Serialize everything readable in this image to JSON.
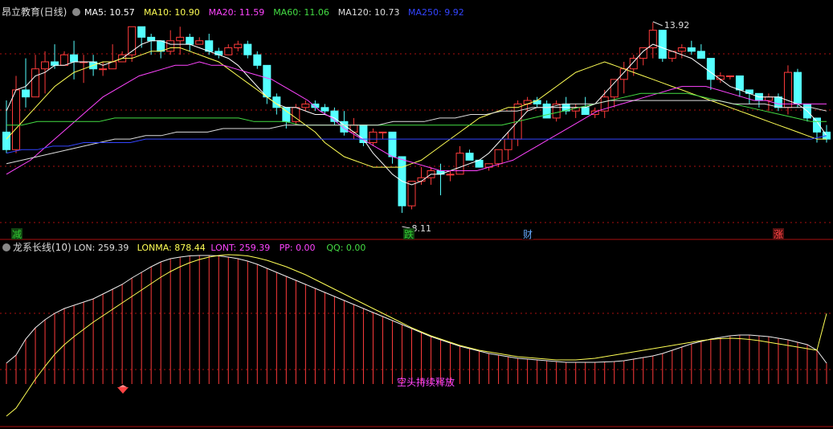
{
  "main_panel": {
    "title": "昂立教育(日线)",
    "ma_labels": [
      {
        "name": "MA5",
        "value": "10.57",
        "color": "#ffffff"
      },
      {
        "name": "MA10",
        "value": "10.90",
        "color": "#ffff55"
      },
      {
        "name": "MA20",
        "value": "11.59",
        "color": "#ff44ff"
      },
      {
        "name": "MA60",
        "value": "11.06",
        "color": "#44dd44"
      },
      {
        "name": "MA120",
        "value": "10.73",
        "color": "#dddddd"
      },
      {
        "name": "MA250",
        "value": "9.92",
        "color": "#3344ff"
      }
    ],
    "high_label": "13.92",
    "low_label": "8.11",
    "markers": [
      {
        "text": "减",
        "color": "#33cc33",
        "bg": "#114411"
      },
      {
        "text": "跌",
        "color": "#33cc33",
        "bg": "#114411"
      },
      {
        "text": "财",
        "color": "#66aaff",
        "bg": "#000000"
      },
      {
        "text": "涨",
        "color": "#ff4444",
        "bg": "#551111"
      }
    ]
  },
  "sub_panel": {
    "title": "龙系长线(10)",
    "labels": [
      {
        "name": "LON",
        "value": "259.39",
        "color": "#dddddd"
      },
      {
        "name": "LONMA",
        "value": "878.44",
        "color": "#ffff55"
      },
      {
        "name": "LONT",
        "value": "259.39",
        "color": "#ff44ff"
      },
      {
        "name": "PP",
        "value": "0.00",
        "color": "#ff44ff"
      },
      {
        "name": "QQ",
        "value": "0.00",
        "color": "#44dd44"
      }
    ],
    "annotation": "空头持续释放"
  },
  "colors": {
    "up": "#ff3b3b",
    "down": "#55ffff",
    "grid": "#aa1111",
    "border": "#aa1111"
  },
  "chart_data": [
    {
      "type": "candlestick",
      "title": "昂立教育(日线)",
      "high_marker": 13.92,
      "low_marker": 8.11,
      "ohlc": [
        [
          10.8,
          11.7,
          10.2,
          10.3
        ],
        [
          10.3,
          12.4,
          10.2,
          12.0
        ],
        [
          12.0,
          12.9,
          11.5,
          11.8
        ],
        [
          11.8,
          13.0,
          11.8,
          12.6
        ],
        [
          12.6,
          13.1,
          11.9,
          12.8
        ],
        [
          12.8,
          13.3,
          12.6,
          12.7
        ],
        [
          12.7,
          13.1,
          12.8,
          13.0
        ],
        [
          13.0,
          13.4,
          12.3,
          12.8
        ],
        [
          12.8,
          13.0,
          12.2,
          12.8
        ],
        [
          12.8,
          13.0,
          12.4,
          12.6
        ],
        [
          12.6,
          12.8,
          12.4,
          12.6
        ],
        [
          12.6,
          13.3,
          12.6,
          12.8
        ],
        [
          12.8,
          13.1,
          12.8,
          13.0
        ],
        [
          13.0,
          13.8,
          12.8,
          13.8
        ],
        [
          13.8,
          13.8,
          13.2,
          13.5
        ],
        [
          13.5,
          13.6,
          13.0,
          13.4
        ],
        [
          13.4,
          13.3,
          12.9,
          13.1
        ],
        [
          13.1,
          13.7,
          13.0,
          13.4
        ],
        [
          13.4,
          13.8,
          13.0,
          13.5
        ],
        [
          13.5,
          13.6,
          13.1,
          13.3
        ],
        [
          13.3,
          13.5,
          13.3,
          13.4
        ],
        [
          13.4,
          13.6,
          13.0,
          13.1
        ],
        [
          13.1,
          13.2,
          12.9,
          13.0
        ],
        [
          13.0,
          13.3,
          13.0,
          13.2
        ],
        [
          13.2,
          13.4,
          13.1,
          13.3
        ],
        [
          13.3,
          13.4,
          12.9,
          13.0
        ],
        [
          13.0,
          13.1,
          12.6,
          12.7
        ],
        [
          12.7,
          12.5,
          11.6,
          11.8
        ],
        [
          11.8,
          11.9,
          11.3,
          11.5
        ],
        [
          11.5,
          11.5,
          10.9,
          11.1
        ],
        [
          11.1,
          11.6,
          11.0,
          11.5
        ],
        [
          11.5,
          11.7,
          11.4,
          11.6
        ],
        [
          11.6,
          11.7,
          11.4,
          11.5
        ],
        [
          11.5,
          11.6,
          11.3,
          11.4
        ],
        [
          11.4,
          11.5,
          11.0,
          11.1
        ],
        [
          11.1,
          11.4,
          10.7,
          10.8
        ],
        [
          10.8,
          11.2,
          10.6,
          11.0
        ],
        [
          11.0,
          11.0,
          10.4,
          10.5
        ],
        [
          10.5,
          10.9,
          10.4,
          10.8
        ],
        [
          10.8,
          10.8,
          10.6,
          10.8
        ],
        [
          10.8,
          10.7,
          9.9,
          10.1
        ],
        [
          10.1,
          8.11,
          8.5,
          8.7
        ],
        [
          8.7,
          9.3,
          8.6,
          9.4
        ],
        [
          9.4,
          9.8,
          9.3,
          9.5
        ],
        [
          9.5,
          9.8,
          9.3,
          9.7
        ],
        [
          9.7,
          9.9,
          9.0,
          9.6
        ],
        [
          9.6,
          9.7,
          9.4,
          9.6
        ],
        [
          9.6,
          10.4,
          9.6,
          10.2
        ],
        [
          10.2,
          10.3,
          10.0,
          10.0
        ],
        [
          10.0,
          9.8,
          9.8,
          9.8
        ],
        [
          9.8,
          9.9,
          9.7,
          9.9
        ],
        [
          9.9,
          10.2,
          9.8,
          10.3
        ],
        [
          10.3,
          10.8,
          10.0,
          10.6
        ],
        [
          10.6,
          11.7,
          10.4,
          11.6
        ],
        [
          11.6,
          11.8,
          11.4,
          11.7
        ],
        [
          11.7,
          11.8,
          11.5,
          11.6
        ],
        [
          11.6,
          11.7,
          11.2,
          11.2
        ],
        [
          11.2,
          11.7,
          11.1,
          11.6
        ],
        [
          11.6,
          11.8,
          11.3,
          11.4
        ],
        [
          11.4,
          11.6,
          11.2,
          11.5
        ],
        [
          11.5,
          11.8,
          11.3,
          11.3
        ],
        [
          11.3,
          11.5,
          11.2,
          11.4
        ],
        [
          11.4,
          12.0,
          11.2,
          11.8
        ],
        [
          11.8,
          12.3,
          11.5,
          12.3
        ],
        [
          12.3,
          12.8,
          11.9,
          12.6
        ],
        [
          12.6,
          13.0,
          12.4,
          12.9
        ],
        [
          12.9,
          13.1,
          12.7,
          13.2
        ],
        [
          13.2,
          13.92,
          12.9,
          13.7
        ],
        [
          13.7,
          13.5,
          12.8,
          12.9
        ],
        [
          12.9,
          13.1,
          12.8,
          13.1
        ],
        [
          13.1,
          13.3,
          12.9,
          13.2
        ],
        [
          13.2,
          13.4,
          13.0,
          13.1
        ],
        [
          13.1,
          13.3,
          12.9,
          12.9
        ],
        [
          12.9,
          12.9,
          12.0,
          12.3
        ],
        [
          12.3,
          12.5,
          12.2,
          12.4
        ],
        [
          12.4,
          12.4,
          12.3,
          12.4
        ],
        [
          12.4,
          12.4,
          11.8,
          12.0
        ],
        [
          12.0,
          12.0,
          11.6,
          11.9
        ],
        [
          11.9,
          11.9,
          11.5,
          11.7
        ],
        [
          11.7,
          11.9,
          11.4,
          11.8
        ],
        [
          11.8,
          11.9,
          11.4,
          11.5
        ],
        [
          11.5,
          12.7,
          11.3,
          12.5
        ],
        [
          12.5,
          12.6,
          11.5,
          11.6
        ],
        [
          11.6,
          11.6,
          11.1,
          11.2
        ],
        [
          11.2,
          11.2,
          10.5,
          10.8
        ],
        [
          10.8,
          11.0,
          10.5,
          10.6
        ]
      ],
      "ma_lines": {
        "MA5": [
          11.4,
          12.0,
          12.1,
          12.4,
          12.5,
          12.7,
          12.7,
          12.8,
          12.8,
          12.8,
          12.7,
          12.8,
          12.9,
          13.1,
          13.3,
          13.4,
          13.4,
          13.3,
          13.3,
          13.3,
          13.2,
          13.1,
          13.0,
          12.9,
          12.7,
          12.4,
          12.1,
          11.8,
          11.6,
          11.5,
          11.5,
          11.4,
          11.3,
          11.3,
          11.2,
          11.0,
          10.8,
          10.6,
          10.2,
          9.9,
          9.6,
          9.4,
          9.3,
          9.4,
          9.6,
          9.6,
          9.7,
          9.8,
          9.9,
          10.0,
          10.2,
          10.5,
          10.8,
          11.1,
          11.4,
          11.5,
          11.5,
          11.5,
          11.5,
          11.5,
          11.5,
          11.6,
          11.9,
          12.2,
          12.5,
          12.8,
          13.1,
          13.3,
          13.2,
          13.1,
          13.0,
          12.9,
          12.7,
          12.5,
          12.3,
          12.1,
          12.0,
          11.9,
          11.8,
          11.8,
          11.8,
          11.7,
          11.6,
          11.4,
          11.1,
          10.7
        ],
        "MA10": [
          10.6,
          10.9,
          11.2,
          11.5,
          11.8,
          12.1,
          12.3,
          12.5,
          12.6,
          12.7,
          12.8,
          12.8,
          12.9,
          12.9,
          13.0,
          13.1,
          13.1,
          13.2,
          13.2,
          13.1,
          13.0,
          12.9,
          12.8,
          12.6,
          12.4,
          12.2,
          12.0,
          11.8,
          11.6,
          11.4,
          11.2,
          11.0,
          10.8,
          10.5,
          10.3,
          10.1,
          10.0,
          9.9,
          9.8,
          9.8,
          9.8,
          9.8,
          9.9,
          10.0,
          10.2,
          10.4,
          10.6,
          10.8,
          11.0,
          11.2,
          11.3,
          11.4,
          11.5,
          11.5,
          11.6,
          11.7,
          11.9,
          12.1,
          12.3,
          12.5,
          12.6,
          12.7,
          12.8,
          12.7,
          12.6,
          12.5,
          12.4,
          12.3,
          12.2,
          12.1,
          12.0,
          11.9,
          11.8,
          11.7,
          11.6,
          11.5,
          11.4,
          11.3,
          11.2,
          11.1,
          11.0,
          10.9,
          10.8,
          10.7,
          10.6,
          10.6
        ],
        "MA20": [
          9.6,
          9.8,
          10.0,
          10.3,
          10.6,
          10.9,
          11.2,
          11.5,
          11.8,
          12.0,
          12.2,
          12.4,
          12.5,
          12.6,
          12.7,
          12.7,
          12.8,
          12.7,
          12.7,
          12.6,
          12.5,
          12.4,
          12.3,
          12.1,
          11.9,
          11.7,
          11.4,
          11.2,
          10.9,
          10.7,
          10.5,
          10.3,
          10.1,
          10.0,
          9.9,
          9.8,
          9.7,
          9.7,
          9.7,
          9.7,
          9.8,
          9.9,
          10.0,
          10.2,
          10.4,
          10.6,
          10.8,
          11.0,
          11.2,
          11.4,
          11.5,
          11.6,
          11.7,
          11.8,
          11.9,
          12.0,
          12.1,
          12.1,
          12.1,
          12.0,
          11.9,
          11.8,
          11.7,
          11.7,
          11.6,
          11.6,
          11.6,
          11.6,
          11.6
        ],
        "MA60": [
          11.0,
          11.0,
          11.1,
          11.1,
          11.1,
          11.1,
          11.1,
          11.2,
          11.2,
          11.2,
          11.2,
          11.2,
          11.2,
          11.2,
          11.2,
          11.2,
          11.1,
          11.1,
          11.1,
          11.0,
          11.0,
          11.0,
          11.0,
          11.0,
          11.0,
          11.0,
          11.0,
          11.0,
          11.0,
          11.0,
          11.0,
          11.0,
          11.0,
          11.1,
          11.2,
          11.3,
          11.4,
          11.5,
          11.6,
          11.7,
          11.8,
          11.9,
          11.9,
          11.9,
          11.9,
          11.8,
          11.7,
          11.6,
          11.5,
          11.4,
          11.3,
          11.2,
          11.1,
          11.1
        ],
        "MA120": [
          9.9,
          10.0,
          10.1,
          10.2,
          10.3,
          10.4,
          10.5,
          10.6,
          10.6,
          10.7,
          10.7,
          10.8,
          10.8,
          10.8,
          10.9,
          10.9,
          10.9,
          10.9,
          11.0,
          11.0,
          11.0,
          11.0,
          11.0,
          11.0,
          11.0,
          11.1,
          11.1,
          11.1,
          11.2,
          11.2,
          11.3,
          11.3,
          11.4,
          11.4,
          11.5,
          11.5,
          11.6,
          11.6,
          11.6,
          11.7,
          11.7,
          11.7,
          11.7,
          11.7,
          11.7,
          11.7,
          11.7,
          11.6,
          11.6,
          11.6,
          11.5,
          11.5,
          11.5,
          11.4
        ],
        "MA250": [
          10.2,
          10.3,
          10.3,
          10.4,
          10.4,
          10.5,
          10.5,
          10.5,
          10.5,
          10.6,
          10.6,
          10.6,
          10.6,
          10.6,
          10.6,
          10.6,
          10.6,
          10.6,
          10.6,
          10.6,
          10.6,
          10.6,
          10.6,
          10.6,
          10.6,
          10.6,
          10.6,
          10.6,
          10.6,
          10.6,
          10.6,
          10.6,
          10.6,
          10.6,
          10.6,
          10.6,
          10.6,
          10.6,
          10.6,
          10.6,
          10.6,
          10.6,
          10.6,
          10.6,
          10.6,
          10.6,
          10.6,
          10.6,
          10.6,
          10.6,
          10.6,
          10.6,
          10.6,
          10.7
        ]
      },
      "series": [
        {
          "name": "MA5",
          "value": 10.57
        },
        {
          "name": "MA10",
          "value": 10.9
        },
        {
          "name": "MA20",
          "value": 11.59
        },
        {
          "name": "MA60",
          "value": 11.06
        },
        {
          "name": "MA120",
          "value": 10.73
        },
        {
          "name": "MA250",
          "value": 9.92
        }
      ]
    },
    {
      "type": "line",
      "title": "龙系长线(10)",
      "series": [
        {
          "name": "LON",
          "values": [
            260,
            360,
            560,
            700,
            800,
            880,
            940,
            980,
            1020,
            1060,
            1120,
            1180,
            1240,
            1320,
            1390,
            1460,
            1520,
            1560,
            1580,
            1595,
            1600,
            1600,
            1595,
            1580,
            1560,
            1530,
            1490,
            1440,
            1390,
            1340,
            1290,
            1240,
            1190,
            1140,
            1090,
            1040,
            990,
            940,
            890,
            840,
            790,
            740,
            690,
            640,
            590,
            550,
            510,
            470,
            440,
            410,
            380,
            360,
            340,
            320,
            310,
            300,
            290,
            280,
            270,
            270,
            270,
            270,
            275,
            280,
            290,
            310,
            330,
            350,
            380,
            420,
            460,
            500,
            530,
            560,
            580,
            600,
            610,
            610,
            600,
            590,
            570,
            550,
            520,
            490,
            420,
            259
          ]
        },
        {
          "name": "LONMA",
          "values": [
            -400,
            -300,
            -120,
            60,
            220,
            370,
            490,
            590,
            680,
            770,
            850,
            930,
            1010,
            1090,
            1170,
            1250,
            1330,
            1400,
            1460,
            1510,
            1550,
            1580,
            1600,
            1610,
            1605,
            1595,
            1570,
            1540,
            1500,
            1460,
            1410,
            1360,
            1300,
            1240,
            1180,
            1120,
            1060,
            1000,
            940,
            880,
            820,
            760,
            700,
            650,
            600,
            560,
            520,
            480,
            450,
            420,
            400,
            380,
            360,
            340,
            330,
            320,
            310,
            300,
            300,
            300,
            310,
            320,
            340,
            360,
            380,
            400,
            420,
            440,
            460,
            480,
            500,
            520,
            540,
            555,
            565,
            570,
            565,
            555,
            540,
            520,
            500,
            480,
            460,
            440,
            420,
            878
          ]
        }
      ],
      "values_current": {
        "LON": 259.39,
        "LONMA": 878.44,
        "LONT": 259.39,
        "PP": 0.0,
        "QQ": 0.0
      }
    }
  ]
}
